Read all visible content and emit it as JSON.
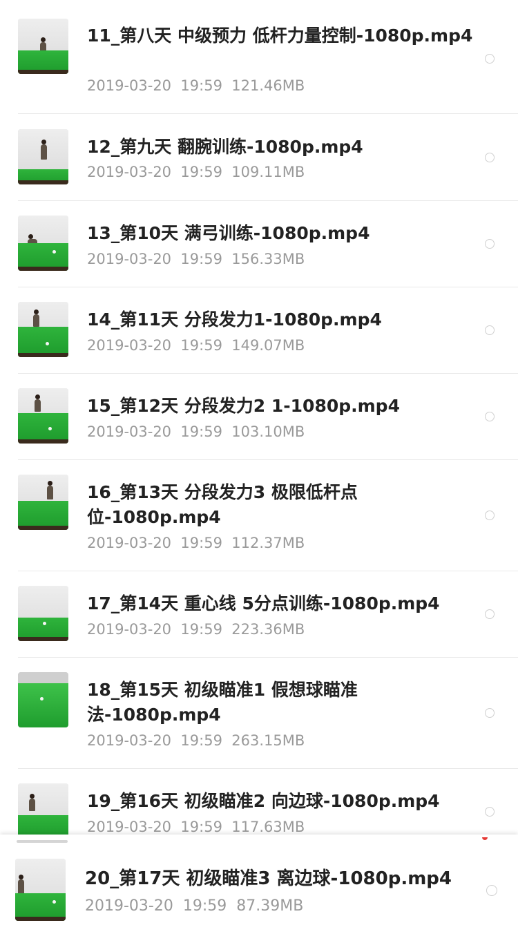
{
  "files": [
    {
      "name": "11_第八天 中级预力 低杆力量控制-1080p.mp4",
      "date": "2019-03-20",
      "time": "19:59",
      "size": "121.46MB",
      "thumb_icon": "billiards-video-thumbnail"
    },
    {
      "name": "12_第九天 翻腕训练-1080p.mp4",
      "date": "2019-03-20",
      "time": "19:59",
      "size": "109.11MB",
      "thumb_icon": "billiards-video-thumbnail"
    },
    {
      "name": "13_第10天 满弓训练-1080p.mp4",
      "date": "2019-03-20",
      "time": "19:59",
      "size": "156.33MB",
      "thumb_icon": "billiards-video-thumbnail"
    },
    {
      "name": "14_第11天 分段发力1-1080p.mp4",
      "date": "2019-03-20",
      "time": "19:59",
      "size": "149.07MB",
      "thumb_icon": "billiards-video-thumbnail"
    },
    {
      "name": "15_第12天 分段发力2 1-1080p.mp4",
      "date": "2019-03-20",
      "time": "19:59",
      "size": "103.10MB",
      "thumb_icon": "billiards-video-thumbnail"
    },
    {
      "name": "16_第13天 分段发力3 极限低杆点位-1080p.mp4",
      "date": "2019-03-20",
      "time": "19:59",
      "size": "112.37MB",
      "thumb_icon": "billiards-video-thumbnail"
    },
    {
      "name": "17_第14天 重心线  5分点训练-1080p.mp4",
      "date": "2019-03-20",
      "time": "19:59",
      "size": "223.36MB",
      "thumb_icon": "billiards-video-thumbnail"
    },
    {
      "name": "18_第15天 初级瞄准1  假想球瞄准法-1080p.mp4",
      "date": "2019-03-20",
      "time": "19:59",
      "size": "263.15MB",
      "thumb_icon": "billiards-video-thumbnail"
    },
    {
      "name": "19_第16天 初级瞄准2 向边球-1080p.mp4",
      "date": "2019-03-20",
      "time": "19:59",
      "size": "117.63MB",
      "thumb_icon": "billiards-video-thumbnail"
    }
  ],
  "pinned_file": {
    "name": "20_第17天 初级瞄准3 离边球-1080p.mp4",
    "date": "2019-03-20",
    "time": "19:59",
    "size": "87.39MB",
    "thumb_icon": "billiards-video-thumbnail"
  },
  "colors": {
    "title_text": "#222222",
    "meta_text": "#9a9a9a",
    "divider": "#e8e8e8",
    "table_felt": "#2fb43c",
    "accent_red": "#e53935"
  }
}
